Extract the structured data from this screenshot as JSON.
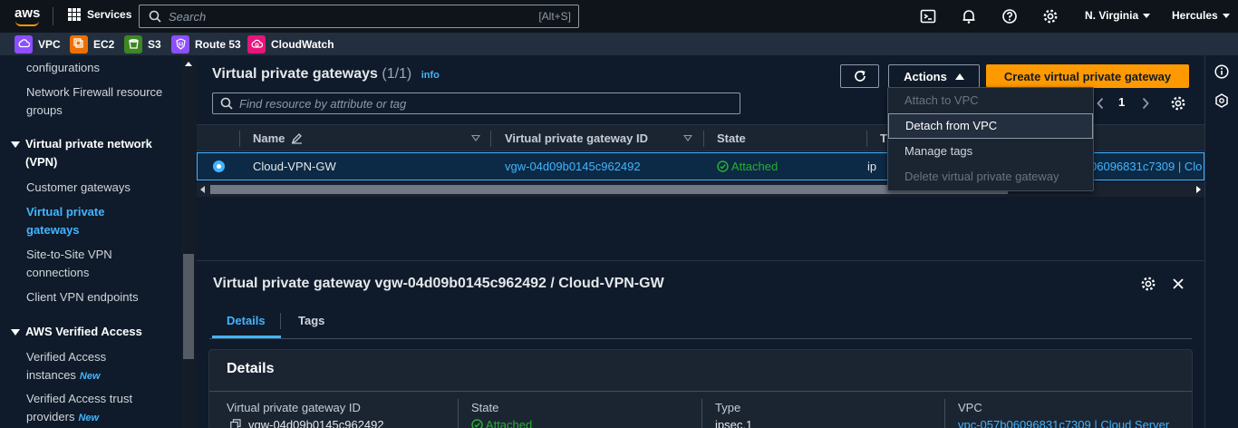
{
  "topnav": {
    "logo": "aws",
    "services_label": "Services",
    "search_placeholder": "Search",
    "search_shortcut": "[Alt+S]",
    "region": "N. Virginia",
    "user": "Hercules",
    "icons": [
      "cloudshell-icon",
      "bell-icon",
      "help-icon",
      "gear-icon"
    ]
  },
  "favorites": [
    {
      "label": "VPC",
      "color": "#8c4fff"
    },
    {
      "label": "EC2",
      "color": "#ed7100"
    },
    {
      "label": "S3",
      "color": "#3f8624"
    },
    {
      "label": "Route 53",
      "color": "#8c4fff"
    },
    {
      "label": "CloudWatch",
      "color": "#e7157b"
    }
  ],
  "sidebar": {
    "items": [
      {
        "label": "configurations"
      },
      {
        "label": "Network Firewall resource groups"
      },
      {
        "section": "Virtual private network (VPN)"
      },
      {
        "label": "Customer gateways"
      },
      {
        "label": "Virtual private gateways",
        "active": true
      },
      {
        "label": "Site-to-Site VPN connections"
      },
      {
        "label": "Client VPN endpoints"
      },
      {
        "section": "AWS Verified Access"
      },
      {
        "label": "Verified Access instances",
        "badge": "New"
      },
      {
        "label": "Verified Access trust providers",
        "badge": "New"
      }
    ]
  },
  "main": {
    "title": "Virtual private gateways",
    "count": "(1/1)",
    "info": "info",
    "actions_label": "Actions",
    "create_label": "Create virtual private gateway",
    "filter_placeholder": "Find resource by attribute or tag",
    "page": "1",
    "columns": [
      "Name",
      "Virtual private gateway ID",
      "State",
      "T"
    ],
    "row": {
      "name": "Cloud-VPN-GW",
      "id": "vgw-04d09b0145c962492",
      "state": "Attached",
      "type_prefix": "ip",
      "vpc_fragment": "06096831c7309 | Clo"
    },
    "actions_menu": [
      {
        "label": "Attach to VPC",
        "disabled": true
      },
      {
        "label": "Detach from VPC",
        "disabled": false,
        "hover": true
      },
      {
        "label": "Manage tags",
        "disabled": false
      },
      {
        "label": "Delete virtual private gateway",
        "disabled": true
      }
    ]
  },
  "detail": {
    "title": "Virtual private gateway vgw-04d09b0145c962492 / Cloud-VPN-GW",
    "tabs": [
      "Details",
      "Tags"
    ],
    "card_title": "Details",
    "fields": [
      {
        "label": "Virtual private gateway ID",
        "value": "vgw-04d09b0145c962492"
      },
      {
        "label": "State",
        "value": "Attached"
      },
      {
        "label": "Type",
        "value": "ipsec.1"
      },
      {
        "label": "VPC",
        "value": "vpc-057b06096831c7309 | Cloud Server"
      }
    ]
  },
  "colors": {
    "accent": "#42b4ff",
    "primary_button": "#ff9900",
    "success": "#29ad32"
  }
}
